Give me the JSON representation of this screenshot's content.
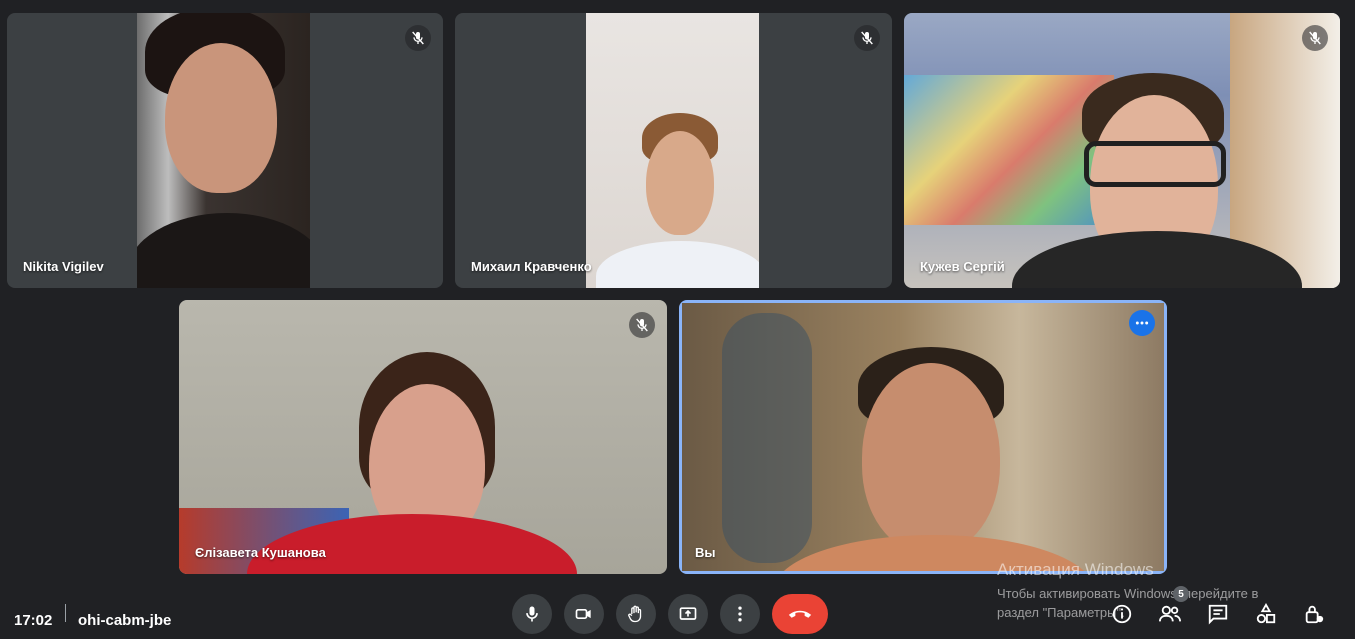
{
  "participants": [
    {
      "name": "Nikita Vigilev",
      "muted": true
    },
    {
      "name": "Михаил Кравченко",
      "muted": true
    },
    {
      "name": "Кужев Сергій",
      "muted": true
    },
    {
      "name": "Єлізавета Кушанова",
      "muted": true
    },
    {
      "name": "Вы",
      "muted": false,
      "more_options": true
    }
  ],
  "bottom_bar": {
    "time": "17:02",
    "meeting_code": "ohi-cabm-jbe",
    "controls": [
      "microphone",
      "camera",
      "raise-hand",
      "present-screen",
      "more-options",
      "leave-call"
    ],
    "right_controls": [
      "meeting-details",
      "people",
      "chat",
      "activities",
      "host-controls"
    ],
    "people_count": "5"
  },
  "watermark": {
    "title": "Активация Windows",
    "line1": "Чтобы активировать Windows, перейдите в",
    "line2": "раздел \"Параметры\"."
  },
  "colors": {
    "background": "#202124",
    "tile": "#3c4043",
    "accent": "#8ab4f8",
    "hangup": "#ea4335"
  }
}
